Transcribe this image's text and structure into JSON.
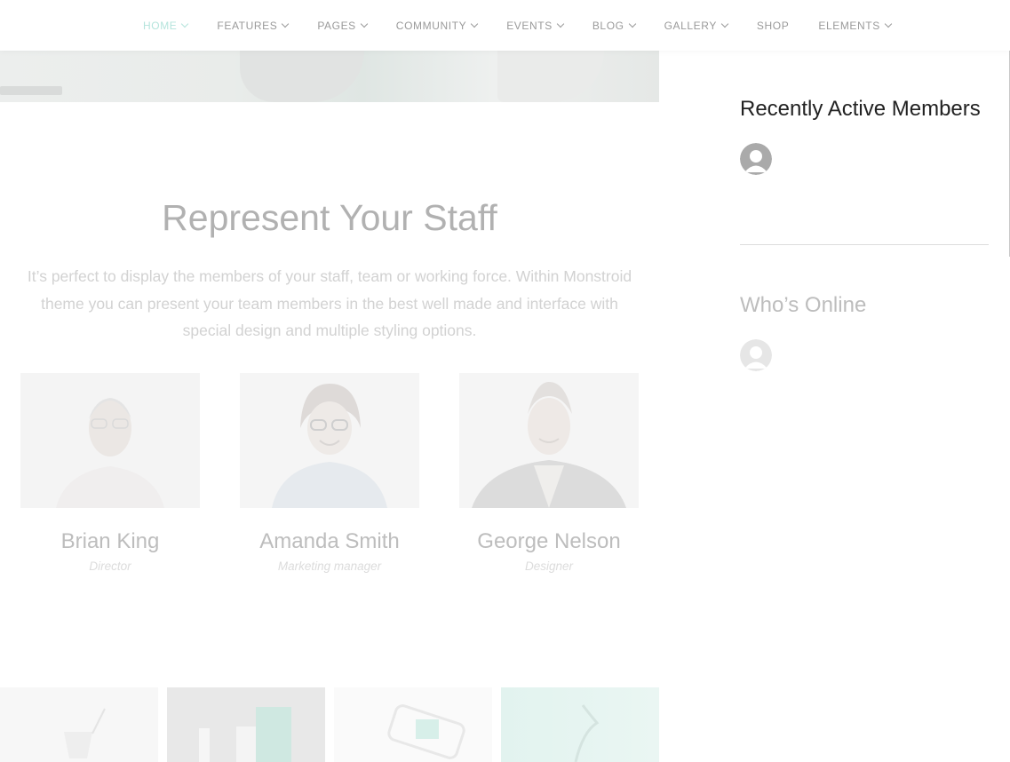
{
  "nav": {
    "items": [
      {
        "label": "HOME",
        "dropdown": true,
        "active": true
      },
      {
        "label": "FEATURES",
        "dropdown": true
      },
      {
        "label": "PAGES",
        "dropdown": true
      },
      {
        "label": "COMMUNITY",
        "dropdown": true
      },
      {
        "label": "EVENTS",
        "dropdown": true
      },
      {
        "label": "BLOG",
        "dropdown": true
      },
      {
        "label": "GALLERY",
        "dropdown": true
      },
      {
        "label": "SHOP",
        "dropdown": false
      },
      {
        "label": "ELEMENTS",
        "dropdown": true
      }
    ]
  },
  "staff": {
    "title": "Represent Your Staff",
    "description": "It’s perfect to display the members of your staff, team or working force. Within Monstroid theme you can present your team members in the best well made and interface with special design and multiple styling options.",
    "members": [
      {
        "name": "Brian King",
        "role": "Director"
      },
      {
        "name": "Amanda Smith",
        "role": "Marketing manager"
      },
      {
        "name": "George Nelson",
        "role": "Designer"
      }
    ]
  },
  "sidebar": {
    "recently_active_title": "Recently Active Members",
    "whos_online_title": "Who’s Online"
  },
  "colors": {
    "nav_active": "#b5e4dc",
    "nav_text": "#9a9a9a",
    "heading_dark": "#222222"
  }
}
